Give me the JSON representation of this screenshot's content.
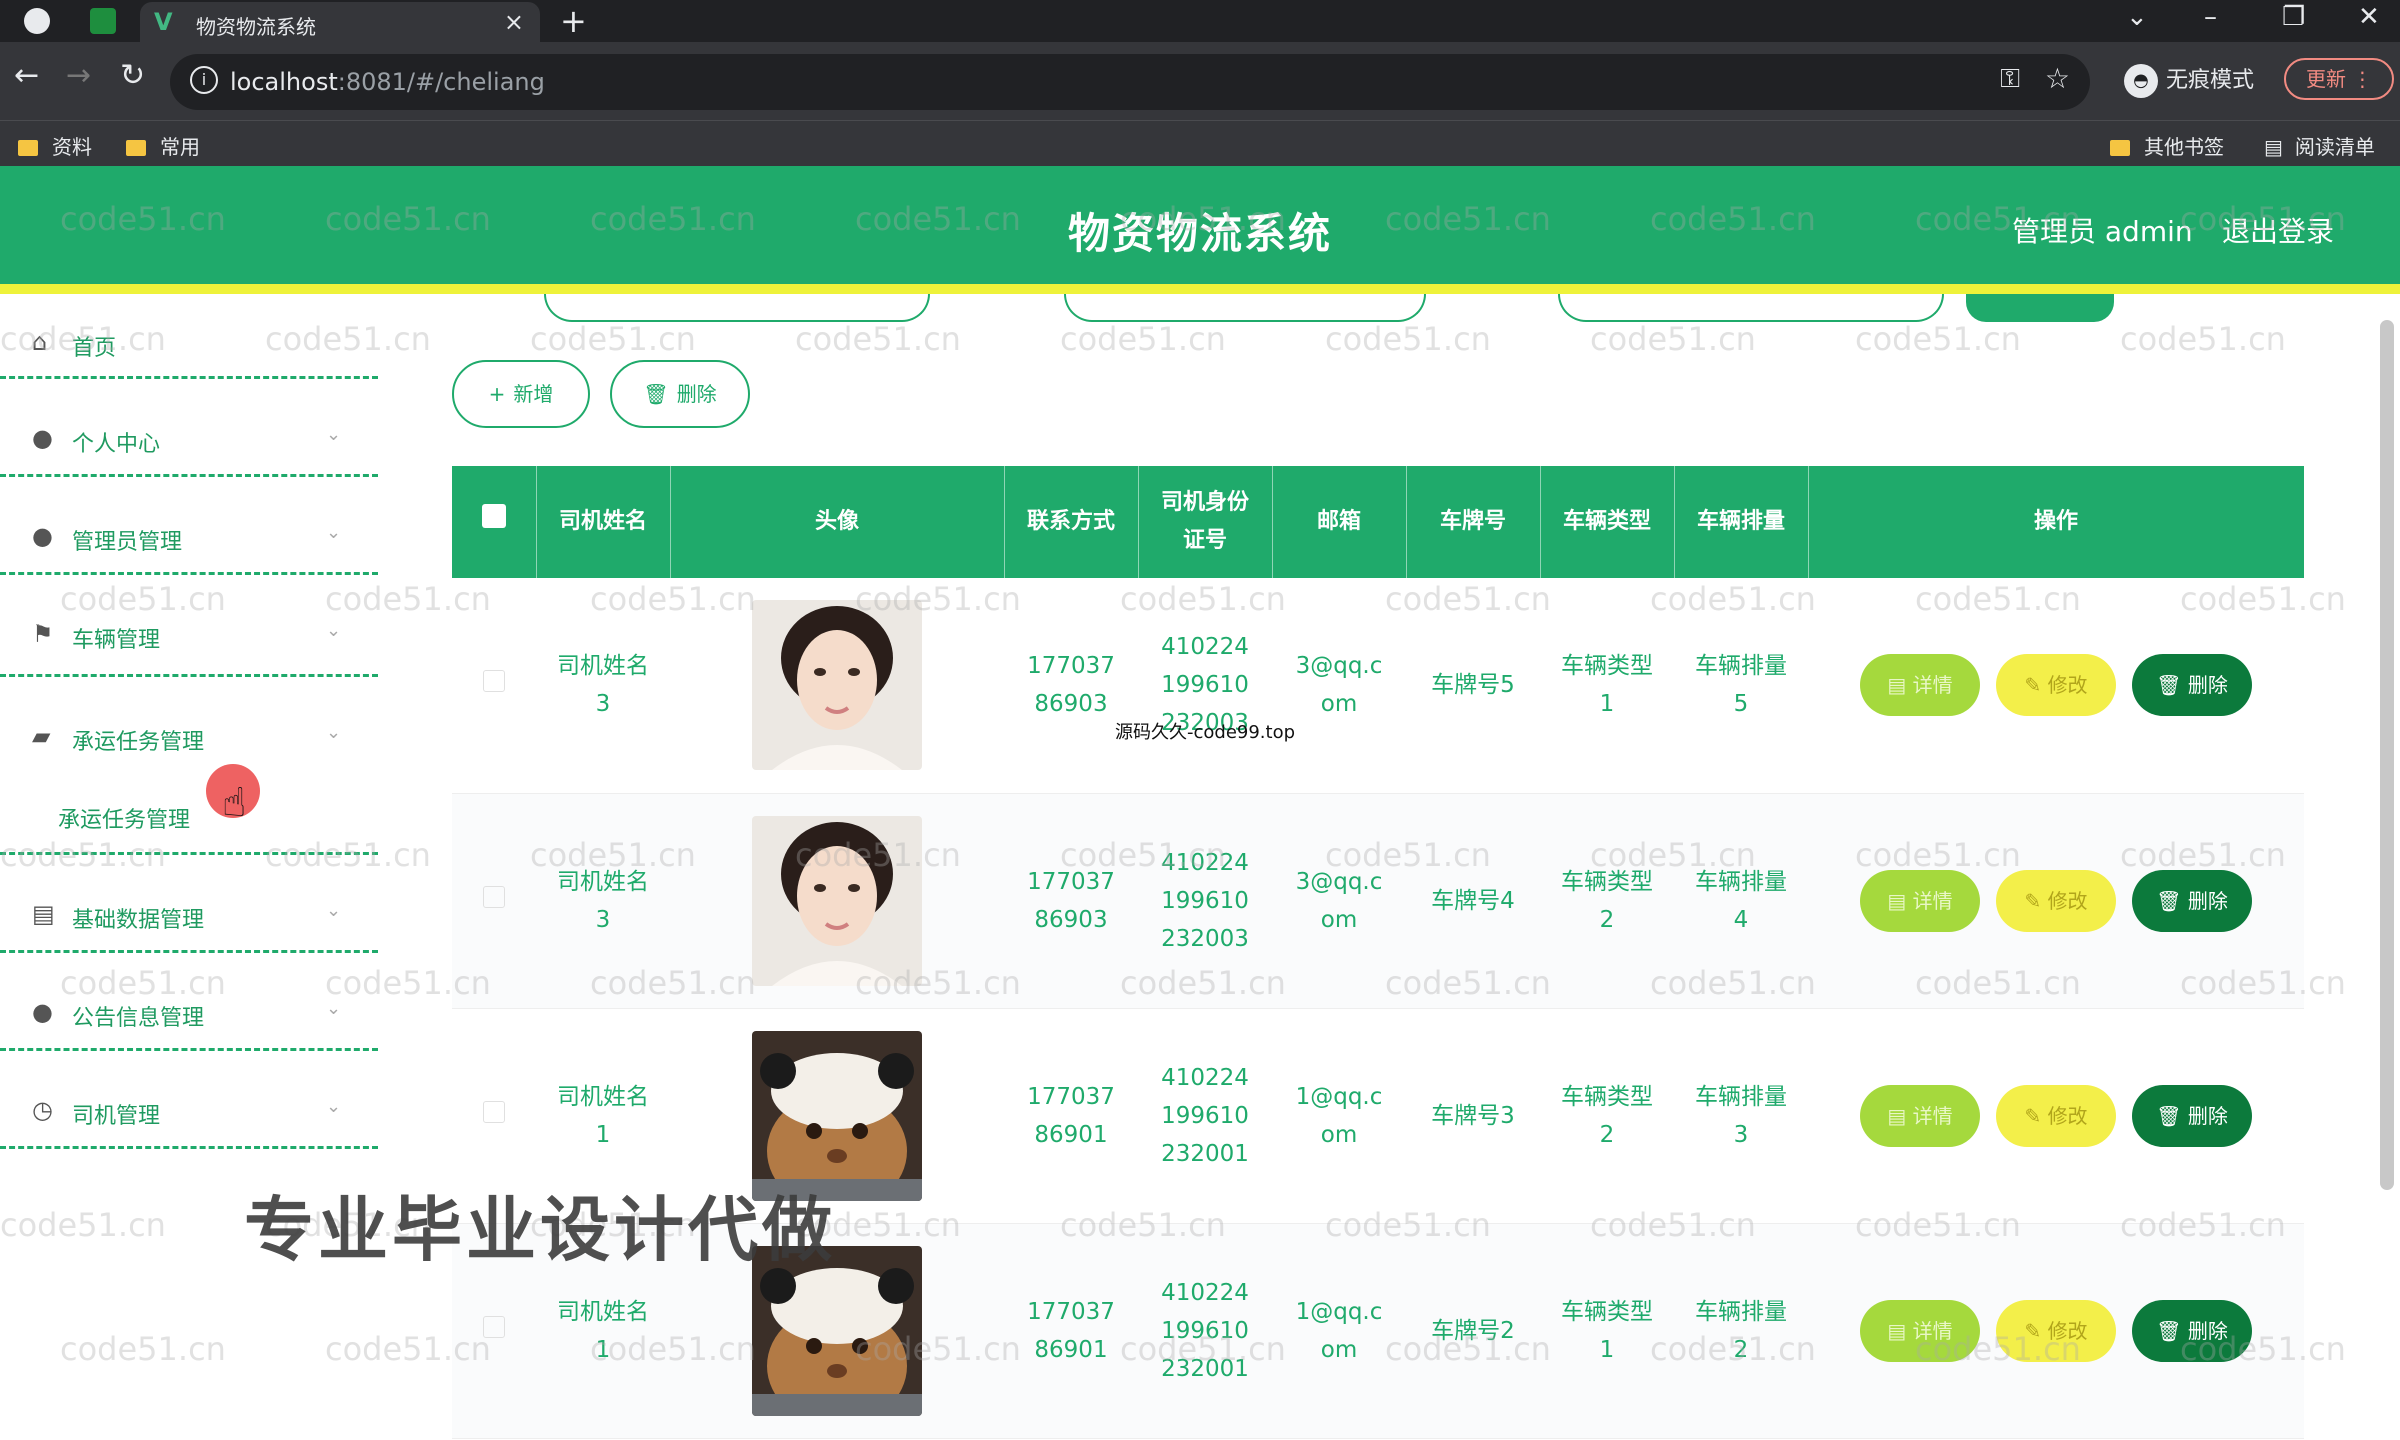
{
  "browser": {
    "tab_title": "物资物流系统",
    "url_host": "localhost",
    "url_rest": ":8081/#/cheliang",
    "incognito_label": "无痕模式",
    "update_label": "更新",
    "bookmarks": [
      {
        "label": "资料"
      },
      {
        "label": "常用"
      }
    ],
    "other_bookmarks": "其他书签",
    "reading_list": "阅读清单"
  },
  "header": {
    "title": "物资物流系统",
    "admin": "管理员 admin",
    "logout": "退出登录"
  },
  "sidebar": {
    "items": [
      {
        "label": "首页",
        "icon": "home-icon"
      },
      {
        "label": "个人中心",
        "icon": "user-icon"
      },
      {
        "label": "管理员管理",
        "icon": "admin-icon"
      },
      {
        "label": "车辆管理",
        "icon": "flag-icon"
      },
      {
        "label": "承运任务管理",
        "icon": "chat-icon"
      },
      {
        "label": "基础数据管理",
        "icon": "briefcase-icon"
      },
      {
        "label": "公告信息管理",
        "icon": "bell-icon"
      },
      {
        "label": "司机管理",
        "icon": "clock-icon"
      }
    ],
    "submenu": {
      "label": "承运任务管理"
    }
  },
  "toolbar": {
    "add_label": "新增",
    "delete_label": "删除"
  },
  "table": {
    "headers": {
      "driver_name": "司机姓名",
      "avatar": "头像",
      "contact": "联系方式",
      "id_card": "司机身份证号",
      "email": "邮箱",
      "plate": "车牌号",
      "vehicle_type": "车辆类型",
      "displacement": "车辆排量",
      "actions": "操作"
    },
    "rows": [
      {
        "driver_name": "司机姓名3",
        "contact": "17703786903",
        "id_card": "410224199610232003",
        "email": "3@qq.com",
        "plate": "车牌号5",
        "vehicle_type": "车辆类型1",
        "displacement": "车辆排量5",
        "avatar": "woman-portrait"
      },
      {
        "driver_name": "司机姓名3",
        "contact": "17703786903",
        "id_card": "410224199610232003",
        "email": "3@qq.com",
        "plate": "车牌号4",
        "vehicle_type": "车辆类型2",
        "displacement": "车辆排量4",
        "avatar": "woman-portrait"
      },
      {
        "driver_name": "司机姓名1",
        "contact": "17703786901",
        "id_card": "410224199610232001",
        "email": "1@qq.com",
        "plate": "车牌号3",
        "vehicle_type": "车辆类型2",
        "displacement": "车辆排量3",
        "avatar": "cat-photo"
      },
      {
        "driver_name": "司机姓名1",
        "contact": "17703786901",
        "id_card": "410224199610232001",
        "email": "1@qq.com",
        "plate": "车牌号2",
        "vehicle_type": "车辆类型1",
        "displacement": "车辆排量2",
        "avatar": "cat-photo"
      }
    ],
    "op_labels": {
      "detail": "详情",
      "edit": "修改",
      "delete": "删除"
    }
  },
  "overlays": {
    "watermark": "code51.cn",
    "source_note": "源码久久-code99.top",
    "banner": "专业毕业设计代做"
  },
  "colors": {
    "primary": "#1faa6b",
    "accent_yellow": "#eef23a",
    "detail_btn": "#a5d93d",
    "edit_btn": "#f3ef4a",
    "delete_btn": "#0c7a3c"
  }
}
